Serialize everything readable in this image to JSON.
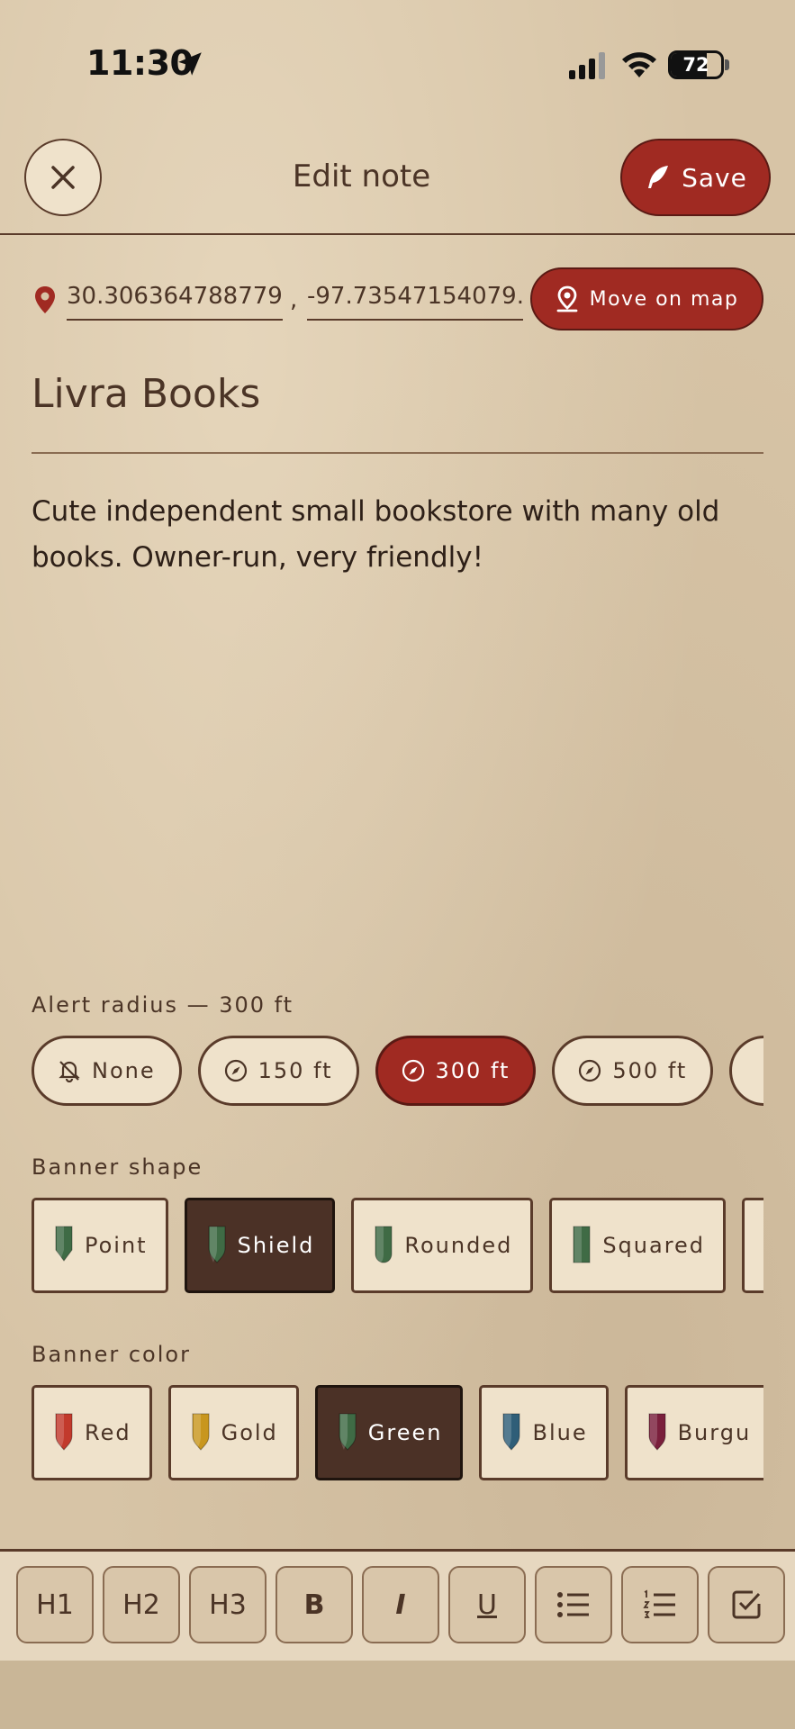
{
  "status_bar": {
    "time": "11:30",
    "battery": "72",
    "battery_level": 0.72
  },
  "header": {
    "title": "Edit note",
    "save_label": "Save"
  },
  "location": {
    "lat": "30.3063647887792",
    "separator": ",",
    "lng": "-97.73547154079...",
    "move_label": "Move on map"
  },
  "note": {
    "title": "Livra Books",
    "body": "Cute independent small bookstore with many old books. Owner-run, very friendly!"
  },
  "alert_radius": {
    "label": "Alert radius — 300 ft",
    "options": [
      {
        "label": "None",
        "icon": "bell-off-icon"
      },
      {
        "label": "150 ft",
        "icon": "compass-icon"
      },
      {
        "label": "300 ft",
        "icon": "compass-icon",
        "selected": true
      },
      {
        "label": "500 ft",
        "icon": "compass-icon"
      }
    ]
  },
  "banner_shape": {
    "label": "Banner shape",
    "options": [
      {
        "label": "Point"
      },
      {
        "label": "Shield",
        "selected": true
      },
      {
        "label": "Rounded"
      },
      {
        "label": "Squared"
      }
    ]
  },
  "banner_color": {
    "label": "Banner color",
    "options": [
      {
        "label": "Red",
        "color": "#c23a2c"
      },
      {
        "label": "Gold",
        "color": "#c8961e"
      },
      {
        "label": "Green",
        "color": "#3f6b45",
        "selected": true
      },
      {
        "label": "Blue",
        "color": "#2f5e78"
      },
      {
        "label": "Burgu",
        "color": "#7a1f3c"
      }
    ]
  },
  "toolbar": {
    "h1": "H1",
    "h2": "H2",
    "h3": "H3",
    "bold": "B",
    "italic": "I",
    "underline": "U"
  },
  "colors": {
    "accent": "#a02a22",
    "ink": "#4b3426",
    "paper": "#efe2cb",
    "selected_tile": "#4b3126"
  }
}
